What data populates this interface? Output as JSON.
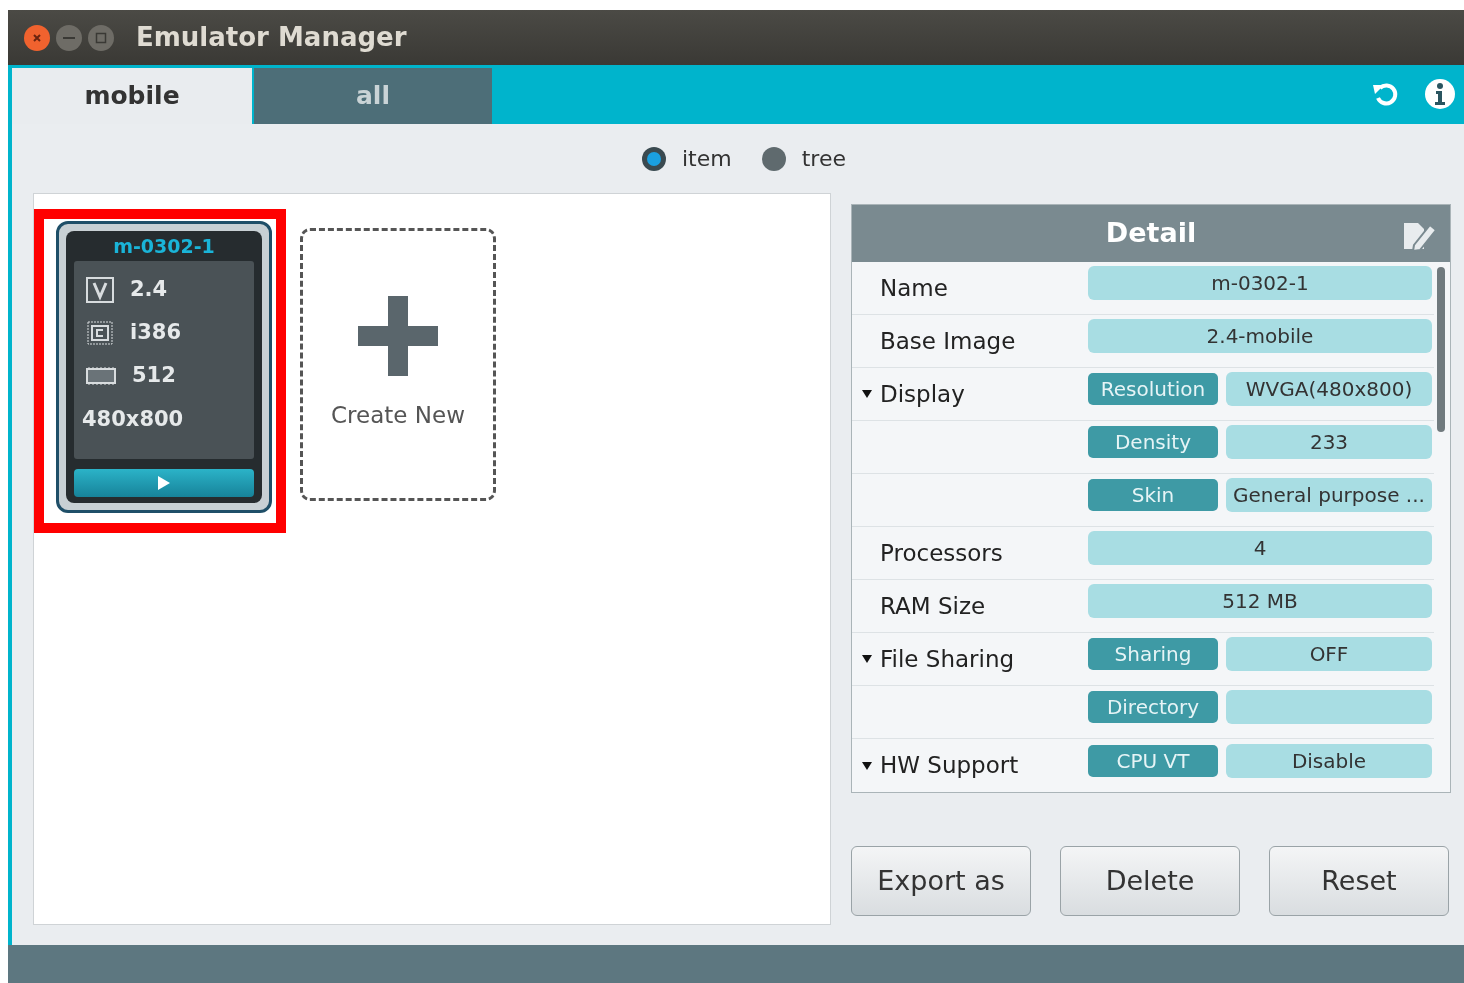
{
  "window": {
    "title": "Emulator Manager"
  },
  "tabs": [
    {
      "label": "mobile",
      "selected": true
    },
    {
      "label": "all",
      "selected": false
    }
  ],
  "view_mode": [
    {
      "label": "item",
      "selected": true
    },
    {
      "label": "tree",
      "selected": false
    }
  ],
  "devices": [
    {
      "name": "m-0302-1",
      "highlighted": true,
      "version": "2.4",
      "cpu": "i386",
      "ram": "512",
      "resolution": "480x800"
    }
  ],
  "create_new": {
    "label": "Create New"
  },
  "detail": {
    "title": "Detail",
    "rows": [
      {
        "kind": "field",
        "label": "Name",
        "value": "m-0302-1"
      },
      {
        "kind": "field",
        "label": "Base Image",
        "value": "2.4-mobile"
      },
      {
        "kind": "group",
        "label": "Display",
        "expanded": true,
        "items": [
          {
            "key": "Resolution",
            "value": "WVGA(480x800)"
          },
          {
            "key": "Density",
            "value": "233"
          },
          {
            "key": "Skin",
            "value": "General purpose ..."
          }
        ]
      },
      {
        "kind": "field",
        "label": "Processors",
        "value": "4"
      },
      {
        "kind": "field",
        "label": "RAM Size",
        "value": "512 MB"
      },
      {
        "kind": "group",
        "label": "File Sharing",
        "expanded": true,
        "items": [
          {
            "key": "Sharing",
            "value": "OFF"
          },
          {
            "key": "Directory"
          }
        ]
      },
      {
        "kind": "group",
        "label": "HW Support",
        "expanded": true,
        "items": [
          {
            "key": "CPU VT",
            "value": "Disable"
          }
        ]
      }
    ]
  },
  "buttons": [
    "Export as",
    "Delete",
    "Reset"
  ]
}
